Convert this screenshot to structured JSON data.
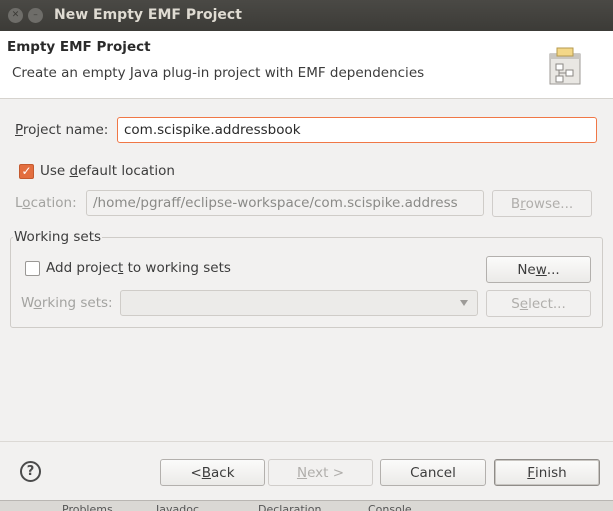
{
  "window": {
    "title": "New Empty EMF Project",
    "close_glyph": "✕",
    "minimize_glyph": "–"
  },
  "banner": {
    "title": "Empty EMF Project",
    "description": "Create an empty Java plug-in project with EMF dependencies",
    "icon": "new-project-wizard-icon"
  },
  "project_name": {
    "label_pre": "",
    "label_mnemonic": "P",
    "label_post": "roject name:",
    "value": "com.scispike.addressbook"
  },
  "use_default_location": {
    "label_pre": "Use ",
    "label_mnemonic": "d",
    "label_post": "efault location",
    "checked": true
  },
  "location": {
    "label_pre": "L",
    "label_mnemonic": "o",
    "label_post": "cation:",
    "value": "/home/pgraff/eclipse-workspace/com.scispike.address",
    "browse_pre": "B",
    "browse_mnemonic": "r",
    "browse_post": "owse..."
  },
  "working_sets_group": {
    "title": "Working sets",
    "add_pre": "Add projec",
    "add_mnemonic": "t",
    "add_post": " to working sets",
    "add_checked": false,
    "new_pre": "Ne",
    "new_mnemonic": "w",
    "new_post": "...",
    "sets_label_pre": "W",
    "sets_label_mnemonic": "o",
    "sets_label_post": "rking sets:",
    "sets_value": "",
    "select_pre": "S",
    "select_mnemonic": "e",
    "select_post": "lect..."
  },
  "footer": {
    "help_glyph": "?",
    "back_pre": "< ",
    "back_mnemonic": "B",
    "back_post": "ack",
    "next_pre": "",
    "next_mnemonic": "N",
    "next_post": "ext >",
    "cancel": "Cancel",
    "finish_pre": "",
    "finish_mnemonic": "F",
    "finish_post": "inish"
  },
  "background_tabs": [
    "Problems",
    "Javadoc",
    "Declaration",
    "Console"
  ],
  "colors": {
    "accent": "#e36e3f",
    "focus_border": "#f07746",
    "titlebar": "#3c3b37"
  }
}
